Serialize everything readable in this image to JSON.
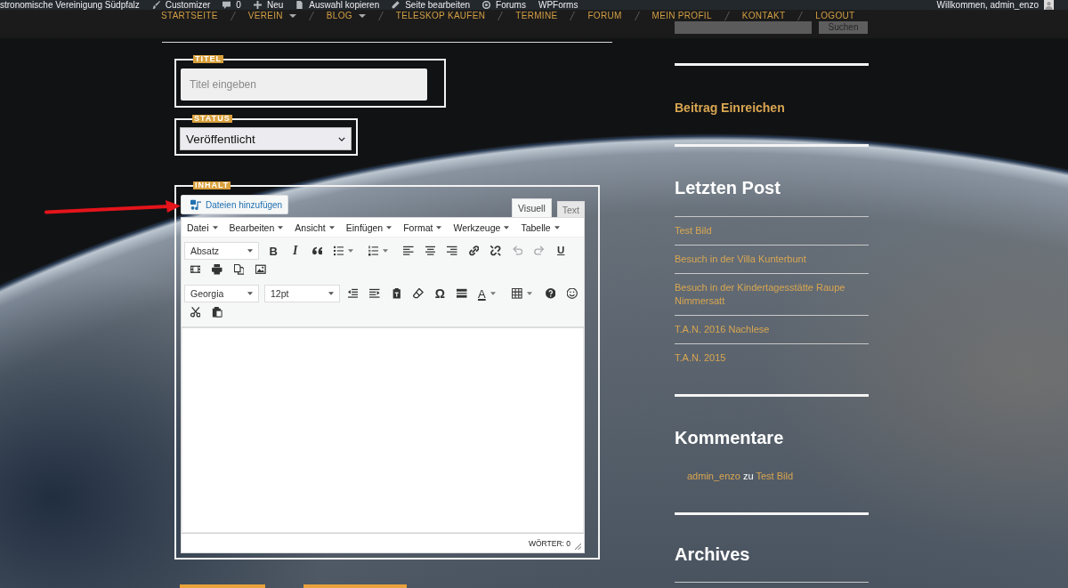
{
  "admin_bar": {
    "site_name": "stronomische Vereinigung Südpfalz",
    "items": [
      {
        "label": "Customizer"
      },
      {
        "label": "0"
      },
      {
        "label": "Neu"
      },
      {
        "label": "Auswahl kopieren"
      },
      {
        "label": "Seite bearbeiten"
      },
      {
        "label": "Forums"
      },
      {
        "label": "WPForms"
      }
    ],
    "greeting": "Willkommen, admin_enzo"
  },
  "nav": [
    {
      "label": "STARTSEITE",
      "dropdown": false
    },
    {
      "label": "VEREIN",
      "dropdown": true
    },
    {
      "label": "BLOG",
      "dropdown": true
    },
    {
      "label": "TELESKOP KAUFEN",
      "dropdown": false
    },
    {
      "label": "TERMINE",
      "dropdown": false
    },
    {
      "label": "FORUM",
      "dropdown": false
    },
    {
      "label": "MEIN PROFIL",
      "dropdown": false
    },
    {
      "label": "KONTAKT",
      "dropdown": false
    },
    {
      "label": "LOGOUT",
      "dropdown": false
    }
  ],
  "form": {
    "title": {
      "legend": "TITEL",
      "placeholder": "Titel eingeben"
    },
    "status": {
      "legend": "STATUS",
      "value": "Veröffentlicht"
    },
    "content": {
      "legend": "INHALT",
      "add_media": "Dateien hinzufügen",
      "tabs": [
        {
          "label": "Visuell",
          "selected": true
        },
        {
          "label": "Text",
          "selected": false
        }
      ],
      "menu": [
        "Datei",
        "Bearbeiten",
        "Ansicht",
        "Einfügen",
        "Format",
        "Werkzeuge",
        "Tabelle"
      ],
      "toolbar": {
        "format": "Absatz",
        "bold": "B",
        "italic": "I",
        "underline": "U",
        "undo": {
          "disabled": true
        },
        "redo": {
          "disabled": true
        },
        "font": "Georgia",
        "size": "12pt",
        "special_character": "Ω",
        "text_color": "A"
      },
      "word_count": "WÖRTER: 0"
    }
  },
  "sidebar": {
    "search_button": "Suchen",
    "submit_link": "Beitrag Einreichen",
    "recent_posts": {
      "title": "Letzten Post",
      "items": [
        "Test Bild",
        "Besuch in der Villa Kunterbunt",
        "Besuch in der Kindertagesstätte Raupe Nimmersatt",
        "T.A.N. 2016 Nachlese",
        "T.A.N. 2015"
      ]
    },
    "comments": {
      "title": "Kommentare",
      "items": [
        {
          "author": "admin_enzo",
          "text": "zu",
          "post": "Test Bild"
        }
      ]
    },
    "archives": {
      "title": "Archives"
    }
  }
}
